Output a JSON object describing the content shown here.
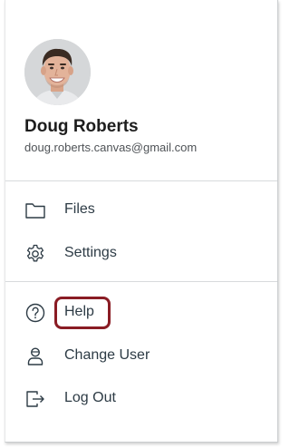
{
  "user": {
    "name": "Doug Roberts",
    "email": "doug.roberts.canvas@gmail.com",
    "avatar_icon": "user-photo"
  },
  "menu": {
    "primary": [
      {
        "label": "Files",
        "icon": "folder-icon"
      },
      {
        "label": "Settings",
        "icon": "gear-icon"
      }
    ],
    "secondary": [
      {
        "label": "Help",
        "icon": "question-circle-icon",
        "highlighted": true
      },
      {
        "label": "Change User",
        "icon": "change-user-icon"
      },
      {
        "label": "Log Out",
        "icon": "logout-icon"
      }
    ]
  },
  "colors": {
    "highlight_border": "#8a1c24",
    "text": "#2d3b45",
    "divider": "#d8dadc"
  }
}
